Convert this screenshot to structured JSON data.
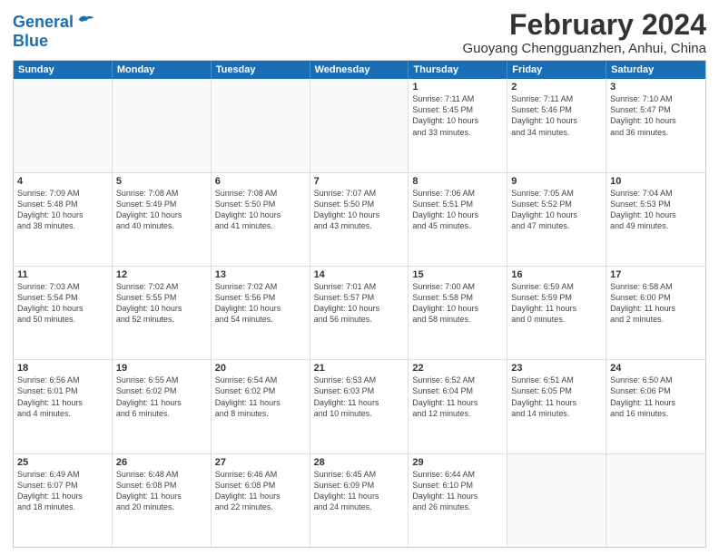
{
  "logo": {
    "line1": "General",
    "line2": "Blue"
  },
  "title": "February 2024",
  "subtitle": "Guoyang Chengguanzhen, Anhui, China",
  "header": {
    "days": [
      "Sunday",
      "Monday",
      "Tuesday",
      "Wednesday",
      "Thursday",
      "Friday",
      "Saturday"
    ]
  },
  "weeks": [
    [
      {
        "day": "",
        "info": "",
        "empty": true
      },
      {
        "day": "",
        "info": "",
        "empty": true
      },
      {
        "day": "",
        "info": "",
        "empty": true
      },
      {
        "day": "",
        "info": "",
        "empty": true
      },
      {
        "day": "1",
        "info": "Sunrise: 7:11 AM\nSunset: 5:45 PM\nDaylight: 10 hours\nand 33 minutes."
      },
      {
        "day": "2",
        "info": "Sunrise: 7:11 AM\nSunset: 5:46 PM\nDaylight: 10 hours\nand 34 minutes."
      },
      {
        "day": "3",
        "info": "Sunrise: 7:10 AM\nSunset: 5:47 PM\nDaylight: 10 hours\nand 36 minutes."
      }
    ],
    [
      {
        "day": "4",
        "info": "Sunrise: 7:09 AM\nSunset: 5:48 PM\nDaylight: 10 hours\nand 38 minutes."
      },
      {
        "day": "5",
        "info": "Sunrise: 7:08 AM\nSunset: 5:49 PM\nDaylight: 10 hours\nand 40 minutes."
      },
      {
        "day": "6",
        "info": "Sunrise: 7:08 AM\nSunset: 5:50 PM\nDaylight: 10 hours\nand 41 minutes."
      },
      {
        "day": "7",
        "info": "Sunrise: 7:07 AM\nSunset: 5:50 PM\nDaylight: 10 hours\nand 43 minutes."
      },
      {
        "day": "8",
        "info": "Sunrise: 7:06 AM\nSunset: 5:51 PM\nDaylight: 10 hours\nand 45 minutes."
      },
      {
        "day": "9",
        "info": "Sunrise: 7:05 AM\nSunset: 5:52 PM\nDaylight: 10 hours\nand 47 minutes."
      },
      {
        "day": "10",
        "info": "Sunrise: 7:04 AM\nSunset: 5:53 PM\nDaylight: 10 hours\nand 49 minutes."
      }
    ],
    [
      {
        "day": "11",
        "info": "Sunrise: 7:03 AM\nSunset: 5:54 PM\nDaylight: 10 hours\nand 50 minutes."
      },
      {
        "day": "12",
        "info": "Sunrise: 7:02 AM\nSunset: 5:55 PM\nDaylight: 10 hours\nand 52 minutes."
      },
      {
        "day": "13",
        "info": "Sunrise: 7:02 AM\nSunset: 5:56 PM\nDaylight: 10 hours\nand 54 minutes."
      },
      {
        "day": "14",
        "info": "Sunrise: 7:01 AM\nSunset: 5:57 PM\nDaylight: 10 hours\nand 56 minutes."
      },
      {
        "day": "15",
        "info": "Sunrise: 7:00 AM\nSunset: 5:58 PM\nDaylight: 10 hours\nand 58 minutes."
      },
      {
        "day": "16",
        "info": "Sunrise: 6:59 AM\nSunset: 5:59 PM\nDaylight: 11 hours\nand 0 minutes."
      },
      {
        "day": "17",
        "info": "Sunrise: 6:58 AM\nSunset: 6:00 PM\nDaylight: 11 hours\nand 2 minutes."
      }
    ],
    [
      {
        "day": "18",
        "info": "Sunrise: 6:56 AM\nSunset: 6:01 PM\nDaylight: 11 hours\nand 4 minutes."
      },
      {
        "day": "19",
        "info": "Sunrise: 6:55 AM\nSunset: 6:02 PM\nDaylight: 11 hours\nand 6 minutes."
      },
      {
        "day": "20",
        "info": "Sunrise: 6:54 AM\nSunset: 6:02 PM\nDaylight: 11 hours\nand 8 minutes."
      },
      {
        "day": "21",
        "info": "Sunrise: 6:53 AM\nSunset: 6:03 PM\nDaylight: 11 hours\nand 10 minutes."
      },
      {
        "day": "22",
        "info": "Sunrise: 6:52 AM\nSunset: 6:04 PM\nDaylight: 11 hours\nand 12 minutes."
      },
      {
        "day": "23",
        "info": "Sunrise: 6:51 AM\nSunset: 6:05 PM\nDaylight: 11 hours\nand 14 minutes."
      },
      {
        "day": "24",
        "info": "Sunrise: 6:50 AM\nSunset: 6:06 PM\nDaylight: 11 hours\nand 16 minutes."
      }
    ],
    [
      {
        "day": "25",
        "info": "Sunrise: 6:49 AM\nSunset: 6:07 PM\nDaylight: 11 hours\nand 18 minutes."
      },
      {
        "day": "26",
        "info": "Sunrise: 6:48 AM\nSunset: 6:08 PM\nDaylight: 11 hours\nand 20 minutes."
      },
      {
        "day": "27",
        "info": "Sunrise: 6:46 AM\nSunset: 6:08 PM\nDaylight: 11 hours\nand 22 minutes."
      },
      {
        "day": "28",
        "info": "Sunrise: 6:45 AM\nSunset: 6:09 PM\nDaylight: 11 hours\nand 24 minutes."
      },
      {
        "day": "29",
        "info": "Sunrise: 6:44 AM\nSunset: 6:10 PM\nDaylight: 11 hours\nand 26 minutes."
      },
      {
        "day": "",
        "info": "",
        "empty": true
      },
      {
        "day": "",
        "info": "",
        "empty": true
      }
    ]
  ]
}
